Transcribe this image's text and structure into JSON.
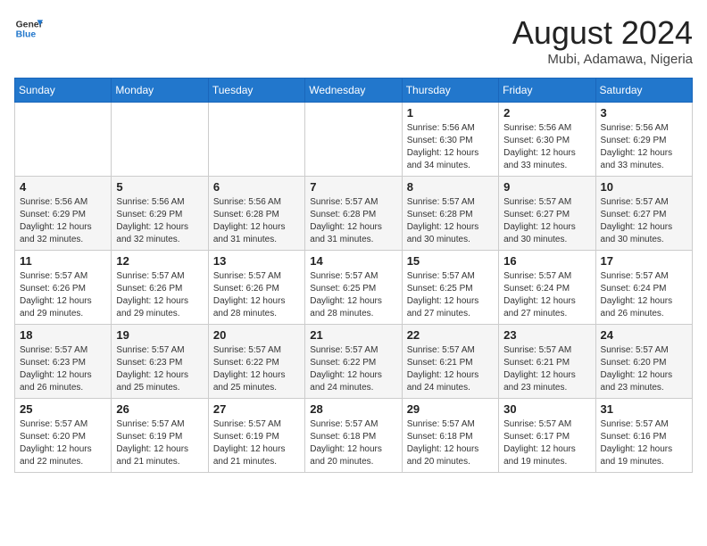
{
  "logo": {
    "line1": "General",
    "line2": "Blue"
  },
  "title": "August 2024",
  "subtitle": "Mubi, Adamawa, Nigeria",
  "days_of_week": [
    "Sunday",
    "Monday",
    "Tuesday",
    "Wednesday",
    "Thursday",
    "Friday",
    "Saturday"
  ],
  "weeks": [
    [
      {
        "day": "",
        "sunrise": "",
        "sunset": "",
        "daylight": ""
      },
      {
        "day": "",
        "sunrise": "",
        "sunset": "",
        "daylight": ""
      },
      {
        "day": "",
        "sunrise": "",
        "sunset": "",
        "daylight": ""
      },
      {
        "day": "",
        "sunrise": "",
        "sunset": "",
        "daylight": ""
      },
      {
        "day": "1",
        "sunrise": "5:56 AM",
        "sunset": "6:30 PM",
        "daylight": "12 hours and 34 minutes."
      },
      {
        "day": "2",
        "sunrise": "5:56 AM",
        "sunset": "6:30 PM",
        "daylight": "12 hours and 33 minutes."
      },
      {
        "day": "3",
        "sunrise": "5:56 AM",
        "sunset": "6:29 PM",
        "daylight": "12 hours and 33 minutes."
      }
    ],
    [
      {
        "day": "4",
        "sunrise": "5:56 AM",
        "sunset": "6:29 PM",
        "daylight": "12 hours and 32 minutes."
      },
      {
        "day": "5",
        "sunrise": "5:56 AM",
        "sunset": "6:29 PM",
        "daylight": "12 hours and 32 minutes."
      },
      {
        "day": "6",
        "sunrise": "5:56 AM",
        "sunset": "6:28 PM",
        "daylight": "12 hours and 31 minutes."
      },
      {
        "day": "7",
        "sunrise": "5:57 AM",
        "sunset": "6:28 PM",
        "daylight": "12 hours and 31 minutes."
      },
      {
        "day": "8",
        "sunrise": "5:57 AM",
        "sunset": "6:28 PM",
        "daylight": "12 hours and 30 minutes."
      },
      {
        "day": "9",
        "sunrise": "5:57 AM",
        "sunset": "6:27 PM",
        "daylight": "12 hours and 30 minutes."
      },
      {
        "day": "10",
        "sunrise": "5:57 AM",
        "sunset": "6:27 PM",
        "daylight": "12 hours and 30 minutes."
      }
    ],
    [
      {
        "day": "11",
        "sunrise": "5:57 AM",
        "sunset": "6:26 PM",
        "daylight": "12 hours and 29 minutes."
      },
      {
        "day": "12",
        "sunrise": "5:57 AM",
        "sunset": "6:26 PM",
        "daylight": "12 hours and 29 minutes."
      },
      {
        "day": "13",
        "sunrise": "5:57 AM",
        "sunset": "6:26 PM",
        "daylight": "12 hours and 28 minutes."
      },
      {
        "day": "14",
        "sunrise": "5:57 AM",
        "sunset": "6:25 PM",
        "daylight": "12 hours and 28 minutes."
      },
      {
        "day": "15",
        "sunrise": "5:57 AM",
        "sunset": "6:25 PM",
        "daylight": "12 hours and 27 minutes."
      },
      {
        "day": "16",
        "sunrise": "5:57 AM",
        "sunset": "6:24 PM",
        "daylight": "12 hours and 27 minutes."
      },
      {
        "day": "17",
        "sunrise": "5:57 AM",
        "sunset": "6:24 PM",
        "daylight": "12 hours and 26 minutes."
      }
    ],
    [
      {
        "day": "18",
        "sunrise": "5:57 AM",
        "sunset": "6:23 PM",
        "daylight": "12 hours and 26 minutes."
      },
      {
        "day": "19",
        "sunrise": "5:57 AM",
        "sunset": "6:23 PM",
        "daylight": "12 hours and 25 minutes."
      },
      {
        "day": "20",
        "sunrise": "5:57 AM",
        "sunset": "6:22 PM",
        "daylight": "12 hours and 25 minutes."
      },
      {
        "day": "21",
        "sunrise": "5:57 AM",
        "sunset": "6:22 PM",
        "daylight": "12 hours and 24 minutes."
      },
      {
        "day": "22",
        "sunrise": "5:57 AM",
        "sunset": "6:21 PM",
        "daylight": "12 hours and 24 minutes."
      },
      {
        "day": "23",
        "sunrise": "5:57 AM",
        "sunset": "6:21 PM",
        "daylight": "12 hours and 23 minutes."
      },
      {
        "day": "24",
        "sunrise": "5:57 AM",
        "sunset": "6:20 PM",
        "daylight": "12 hours and 23 minutes."
      }
    ],
    [
      {
        "day": "25",
        "sunrise": "5:57 AM",
        "sunset": "6:20 PM",
        "daylight": "12 hours and 22 minutes."
      },
      {
        "day": "26",
        "sunrise": "5:57 AM",
        "sunset": "6:19 PM",
        "daylight": "12 hours and 21 minutes."
      },
      {
        "day": "27",
        "sunrise": "5:57 AM",
        "sunset": "6:19 PM",
        "daylight": "12 hours and 21 minutes."
      },
      {
        "day": "28",
        "sunrise": "5:57 AM",
        "sunset": "6:18 PM",
        "daylight": "12 hours and 20 minutes."
      },
      {
        "day": "29",
        "sunrise": "5:57 AM",
        "sunset": "6:18 PM",
        "daylight": "12 hours and 20 minutes."
      },
      {
        "day": "30",
        "sunrise": "5:57 AM",
        "sunset": "6:17 PM",
        "daylight": "12 hours and 19 minutes."
      },
      {
        "day": "31",
        "sunrise": "5:57 AM",
        "sunset": "6:16 PM",
        "daylight": "12 hours and 19 minutes."
      }
    ]
  ],
  "labels": {
    "sunrise_prefix": "Sunrise: ",
    "sunset_prefix": "Sunset: ",
    "daylight_prefix": "Daylight: "
  }
}
